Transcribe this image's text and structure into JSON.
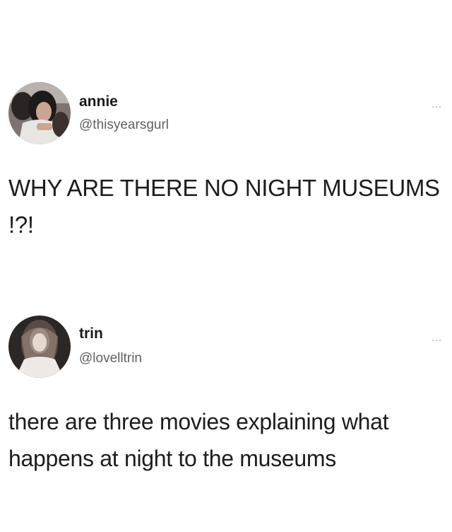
{
  "tweets": [
    {
      "name": "annie",
      "handle": "@thisyearsgurl",
      "text": "WHY ARE THERE NO NIGHT MUSEUMS !?!",
      "more": "..."
    },
    {
      "name": "trin",
      "handle": "@lovelltrin",
      "text": "there are three movies explaining what happens at night to the museums",
      "more": "..."
    }
  ]
}
